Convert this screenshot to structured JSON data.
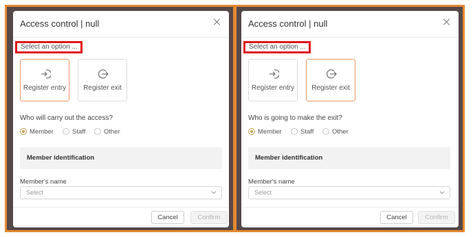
{
  "panels": [
    {
      "title": "Access control | null",
      "select_option_label": "Select an option ...",
      "options": [
        {
          "label": "Register entry",
          "icon": "login-icon",
          "selected": true
        },
        {
          "label": "Register exit",
          "icon": "logout-icon",
          "selected": false
        }
      ],
      "question": "Who will carry out the access?",
      "radios": [
        {
          "label": "Member",
          "checked": true
        },
        {
          "label": "Staff",
          "checked": false
        },
        {
          "label": "Other",
          "checked": false
        }
      ],
      "section_title": "Member identification",
      "field_label": "Member's name",
      "select_placeholder": "Select",
      "cancel_label": "Cancel",
      "confirm_label": "Confirm"
    },
    {
      "title": "Access control | null",
      "select_option_label": "Select an option ...",
      "options": [
        {
          "label": "Register entry",
          "icon": "login-icon",
          "selected": false
        },
        {
          "label": "Register exit",
          "icon": "logout-icon",
          "selected": true
        }
      ],
      "question": "Who is going to make the exit?",
      "radios": [
        {
          "label": "Member",
          "checked": true
        },
        {
          "label": "Staff",
          "checked": false
        },
        {
          "label": "Other",
          "checked": false
        }
      ],
      "section_title": "Member identification",
      "field_label": "Member's name",
      "select_placeholder": "Select",
      "cancel_label": "Cancel",
      "confirm_label": "Confirm"
    }
  ],
  "colors": {
    "frame_border": "#e5892f",
    "highlight_box": "#e0151b",
    "selected_option_border": "#e89a68",
    "radio_accent": "#c9a14b"
  }
}
